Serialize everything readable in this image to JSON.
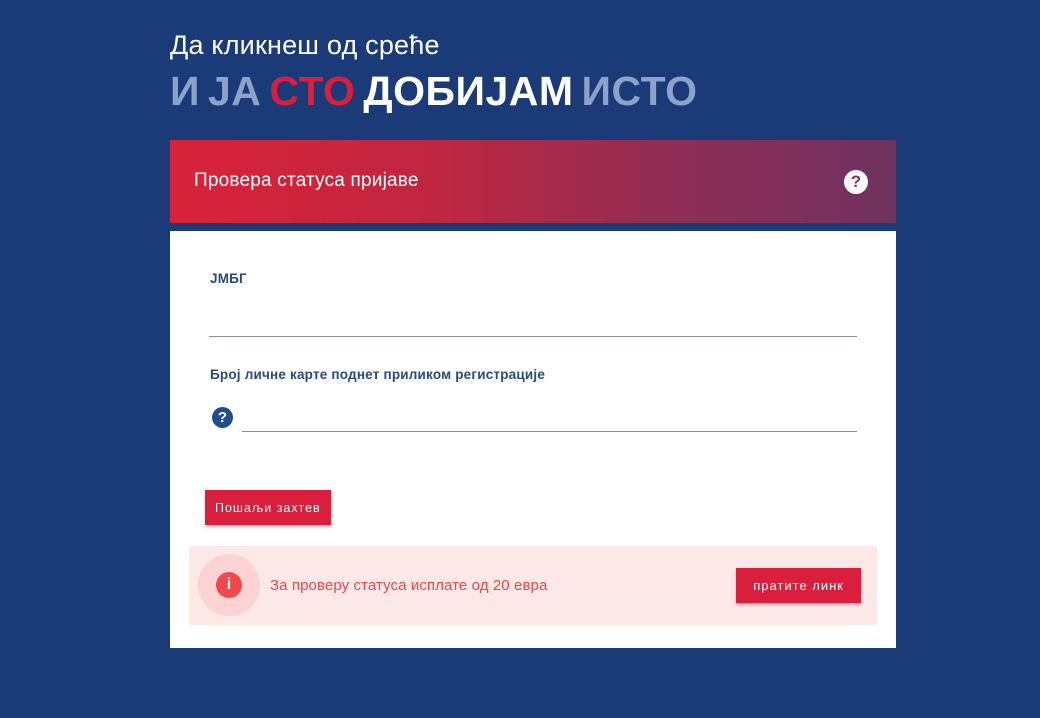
{
  "hero": {
    "subtitle": "Да кликнеш од среће",
    "words": [
      "И",
      "ЈА",
      "СТО",
      "ДОБИЈАМ",
      "ИСТО"
    ]
  },
  "card": {
    "title": "Провера статуса пријаве",
    "help_icon": "question-circle-icon"
  },
  "form": {
    "jmbg_label": "ЈМБГ",
    "jmbg_value": "",
    "id_card_label": "Број личне карте поднет приликом регистрације",
    "id_card_value": "",
    "id_card_help_icon": "question-circle-icon",
    "submit_label": "Пошаљи захтев"
  },
  "notice": {
    "icon": "info-circle-icon",
    "text": "За проверу статуса исплате од 20 евра",
    "button_label": "пратите линк"
  },
  "colors": {
    "background": "#1a3a78",
    "accent_red": "#d91f3b",
    "muted_blue": "#8ba3c9",
    "notice_bg": "#fde8e8",
    "notice_text": "#e24a4c"
  }
}
